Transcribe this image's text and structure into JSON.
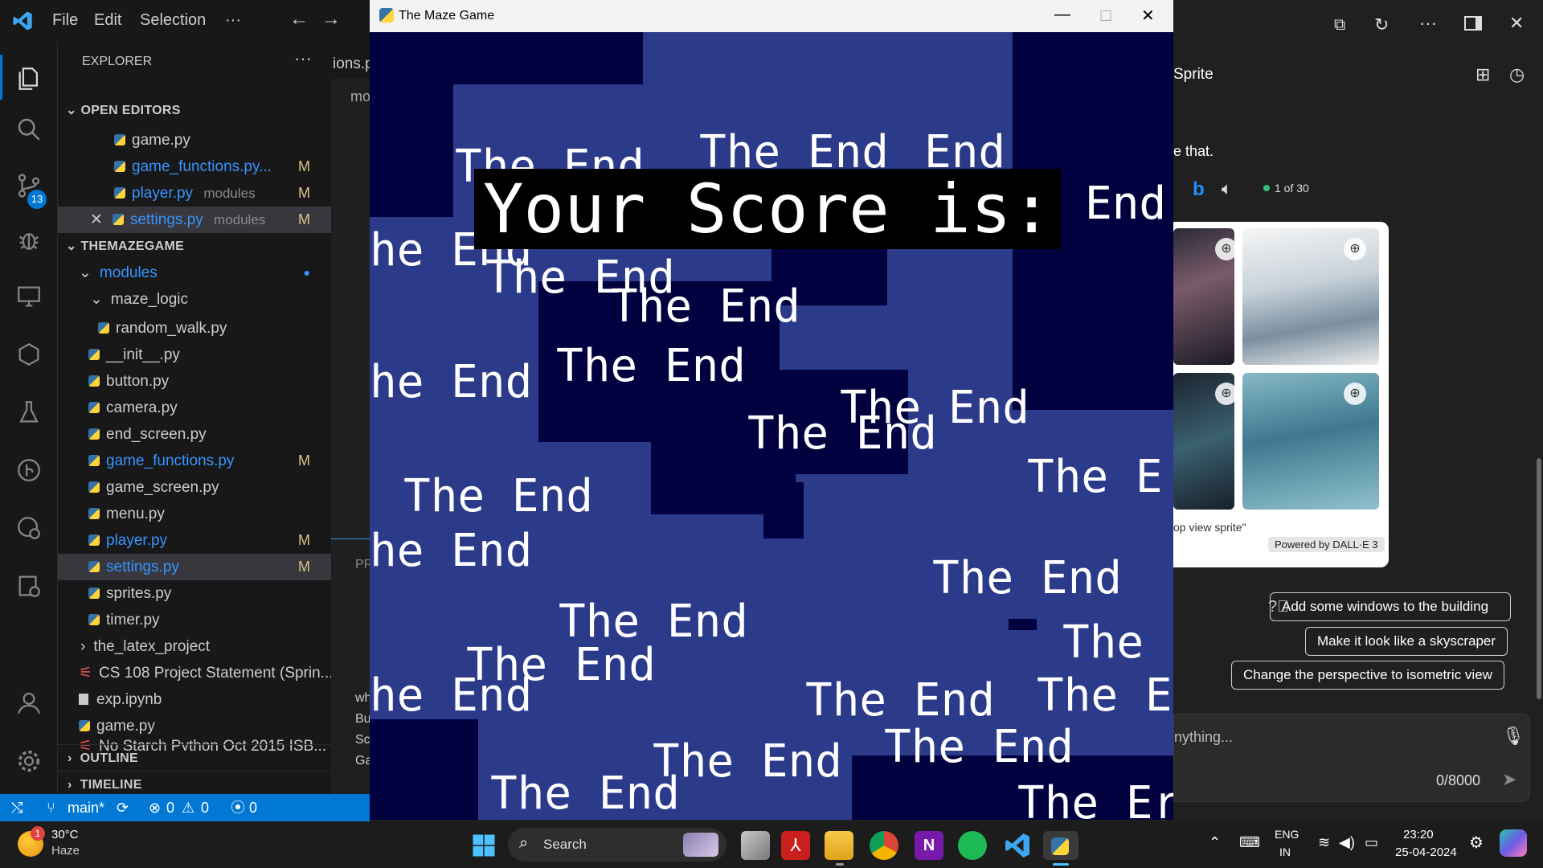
{
  "vscode": {
    "menu": [
      "File",
      "Edit",
      "Selection",
      "···"
    ],
    "explorer_title": "EXPLORER",
    "explorer_more": "···",
    "open_editors_title": "OPEN EDITORS",
    "open_editors": [
      {
        "name": "game.py",
        "detail": "",
        "mark": ""
      },
      {
        "name": "game_functions.py...",
        "detail": "",
        "mark": "M"
      },
      {
        "name": "player.py",
        "detail": "modules",
        "mark": "M"
      },
      {
        "name": "settings.py",
        "detail": "modules",
        "mark": "M"
      }
    ],
    "project_title": "THEMAZEGAME",
    "tree": [
      {
        "name": "modules",
        "kind": "folder",
        "mark": "●"
      },
      {
        "name": "maze_logic",
        "kind": "folder",
        "mark": ""
      },
      {
        "name": "random_walk.py",
        "kind": "file",
        "mark": ""
      },
      {
        "name": "__init__.py",
        "kind": "file",
        "mark": ""
      },
      {
        "name": "button.py",
        "kind": "file",
        "mark": ""
      },
      {
        "name": "camera.py",
        "kind": "file",
        "mark": ""
      },
      {
        "name": "end_screen.py",
        "kind": "file",
        "mark": ""
      },
      {
        "name": "game_functions.py",
        "kind": "file",
        "mark": "M"
      },
      {
        "name": "game_screen.py",
        "kind": "file",
        "mark": ""
      },
      {
        "name": "menu.py",
        "kind": "file",
        "mark": ""
      },
      {
        "name": "player.py",
        "kind": "file",
        "mark": "M"
      },
      {
        "name": "settings.py",
        "kind": "file",
        "mark": "M"
      },
      {
        "name": "sprites.py",
        "kind": "file",
        "mark": ""
      },
      {
        "name": "timer.py",
        "kind": "file",
        "mark": ""
      },
      {
        "name": "the_latex_project",
        "kind": "folder",
        "mark": ""
      },
      {
        "name": "CS 108 Project Statement (Sprin...",
        "kind": "pdf",
        "mark": ""
      },
      {
        "name": "exp.ipynb",
        "kind": "file",
        "mark": ""
      },
      {
        "name": "game.py",
        "kind": "file",
        "mark": ""
      },
      {
        "name": "No Starch Python Oct  2015 ISB...",
        "kind": "pdf",
        "mark": ""
      }
    ],
    "outline": "OUTLINE",
    "timeline": "TIMELINE",
    "editor_tab_partial": "ions.p",
    "editor_breadcrumb_partial": "mo",
    "panel_partial": [
      "PR",
      "wh",
      "Bu",
      "Sc",
      "Ga"
    ],
    "status": {
      "branch": "main*",
      "errors": "0",
      "warnings": "0",
      "ports": "0"
    },
    "explorer_badge": "13"
  },
  "game": {
    "window_title": "The Maze Game",
    "score_label": "Your Score is:",
    "end_text": "The End",
    "end_partial_e": "The E",
    "end_partial_er": "The Er",
    "end_word": "End",
    "end_partial_he": "he End",
    "end_the": "The"
  },
  "copilot": {
    "sprite_partial": "Sprite",
    "that_partial": "e that.",
    "counter": "1 of 30",
    "caption_partial": "op view sprite\"",
    "powered": "Powered by DALL·E 3",
    "suggestions": [
      "Add some windows to the building",
      "Make it look like a skyscraper",
      "Change the perspective to isometric view"
    ],
    "input_placeholder": "nything...",
    "char_count": "0/8000"
  },
  "taskbar": {
    "weather_temp": "30°C",
    "weather_desc": "Haze",
    "weather_badge": "1",
    "search_label": "Search",
    "lang_top": "ENG",
    "lang_bottom": "IN",
    "time": "23:20",
    "date": "25-04-2024"
  },
  "colors": {
    "vscode_blue": "#0078d4",
    "game_bg": "#2c3a8a",
    "maze_dark": "#01013f",
    "accent": "#3794ff"
  }
}
